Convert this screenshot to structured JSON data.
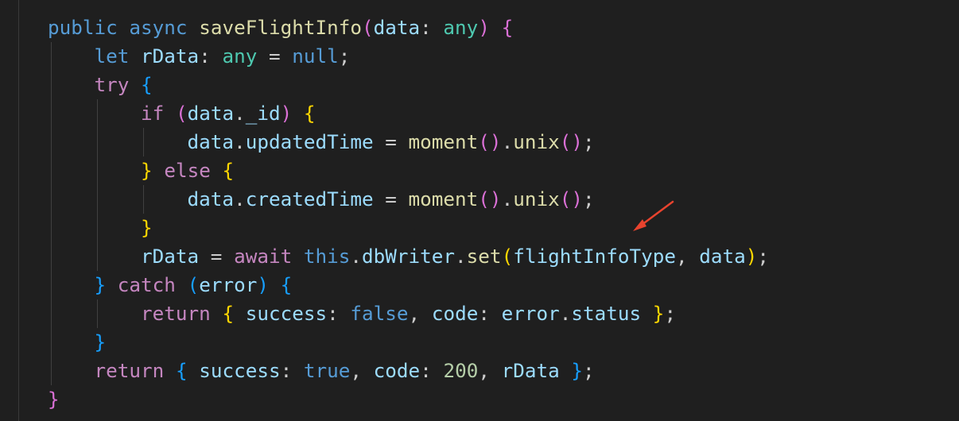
{
  "editor": {
    "lines": [
      {
        "indent": 0,
        "tokens": [
          {
            "t": "public",
            "c": "kw-decl"
          },
          {
            "t": " ",
            "c": "punc"
          },
          {
            "t": "async",
            "c": "kw-decl"
          },
          {
            "t": " ",
            "c": "punc"
          },
          {
            "t": "saveFlightInfo",
            "c": "fn"
          },
          {
            "t": "(",
            "c": "b1"
          },
          {
            "t": "data",
            "c": "var"
          },
          {
            "t": ": ",
            "c": "punc"
          },
          {
            "t": "any",
            "c": "type"
          },
          {
            "t": ")",
            "c": "b1"
          },
          {
            "t": " ",
            "c": "punc"
          },
          {
            "t": "{",
            "c": "b1"
          }
        ]
      },
      {
        "indent": 1,
        "tokens": [
          {
            "t": "let",
            "c": "kw-decl"
          },
          {
            "t": " ",
            "c": "punc"
          },
          {
            "t": "rData",
            "c": "var"
          },
          {
            "t": ": ",
            "c": "punc"
          },
          {
            "t": "any",
            "c": "type"
          },
          {
            "t": " = ",
            "c": "punc"
          },
          {
            "t": "null",
            "c": "kw-decl"
          },
          {
            "t": ";",
            "c": "punc"
          }
        ]
      },
      {
        "indent": 1,
        "tokens": [
          {
            "t": "try",
            "c": "kw-ctrl"
          },
          {
            "t": " ",
            "c": "punc"
          },
          {
            "t": "{",
            "c": "b3"
          }
        ]
      },
      {
        "indent": 2,
        "tokens": [
          {
            "t": "if",
            "c": "kw-ctrl"
          },
          {
            "t": " ",
            "c": "punc"
          },
          {
            "t": "(",
            "c": "b1"
          },
          {
            "t": "data",
            "c": "var"
          },
          {
            "t": ".",
            "c": "punc"
          },
          {
            "t": "_id",
            "c": "var"
          },
          {
            "t": ")",
            "c": "b1"
          },
          {
            "t": " ",
            "c": "punc"
          },
          {
            "t": "{",
            "c": "b2"
          }
        ]
      },
      {
        "indent": 3,
        "tokens": [
          {
            "t": "data",
            "c": "var"
          },
          {
            "t": ".",
            "c": "punc"
          },
          {
            "t": "updatedTime",
            "c": "var"
          },
          {
            "t": " = ",
            "c": "punc"
          },
          {
            "t": "moment",
            "c": "fn"
          },
          {
            "t": "()",
            "c": "b1"
          },
          {
            "t": ".",
            "c": "punc"
          },
          {
            "t": "unix",
            "c": "fn"
          },
          {
            "t": "()",
            "c": "b1"
          },
          {
            "t": ";",
            "c": "punc"
          }
        ]
      },
      {
        "indent": 2,
        "tokens": [
          {
            "t": "}",
            "c": "b2"
          },
          {
            "t": " ",
            "c": "punc"
          },
          {
            "t": "else",
            "c": "kw-ctrl"
          },
          {
            "t": " ",
            "c": "punc"
          },
          {
            "t": "{",
            "c": "b2"
          }
        ]
      },
      {
        "indent": 3,
        "tokens": [
          {
            "t": "data",
            "c": "var"
          },
          {
            "t": ".",
            "c": "punc"
          },
          {
            "t": "createdTime",
            "c": "var"
          },
          {
            "t": " = ",
            "c": "punc"
          },
          {
            "t": "moment",
            "c": "fn"
          },
          {
            "t": "()",
            "c": "b1"
          },
          {
            "t": ".",
            "c": "punc"
          },
          {
            "t": "unix",
            "c": "fn"
          },
          {
            "t": "()",
            "c": "b1"
          },
          {
            "t": ";",
            "c": "punc"
          }
        ]
      },
      {
        "indent": 2,
        "tokens": [
          {
            "t": "}",
            "c": "b2"
          }
        ]
      },
      {
        "indent": 2,
        "tokens": [
          {
            "t": "rData",
            "c": "var"
          },
          {
            "t": " = ",
            "c": "punc"
          },
          {
            "t": "await",
            "c": "kw-ctrl"
          },
          {
            "t": " ",
            "c": "punc"
          },
          {
            "t": "this",
            "c": "kw-decl"
          },
          {
            "t": ".",
            "c": "punc"
          },
          {
            "t": "dbWriter",
            "c": "var"
          },
          {
            "t": ".",
            "c": "punc"
          },
          {
            "t": "set",
            "c": "fn"
          },
          {
            "t": "(",
            "c": "b2"
          },
          {
            "t": "flightInfoType",
            "c": "var"
          },
          {
            "t": ", ",
            "c": "punc"
          },
          {
            "t": "data",
            "c": "var"
          },
          {
            "t": ")",
            "c": "b2"
          },
          {
            "t": ";",
            "c": "punc"
          }
        ]
      },
      {
        "indent": 1,
        "tokens": [
          {
            "t": "}",
            "c": "b3"
          },
          {
            "t": " ",
            "c": "punc"
          },
          {
            "t": "catch",
            "c": "kw-ctrl"
          },
          {
            "t": " ",
            "c": "punc"
          },
          {
            "t": "(",
            "c": "b3"
          },
          {
            "t": "error",
            "c": "var"
          },
          {
            "t": ")",
            "c": "b3"
          },
          {
            "t": " ",
            "c": "punc"
          },
          {
            "t": "{",
            "c": "b3"
          }
        ]
      },
      {
        "indent": 2,
        "tokens": [
          {
            "t": "return",
            "c": "kw-ctrl"
          },
          {
            "t": " ",
            "c": "punc"
          },
          {
            "t": "{",
            "c": "b2"
          },
          {
            "t": " ",
            "c": "punc"
          },
          {
            "t": "success",
            "c": "var"
          },
          {
            "t": ": ",
            "c": "punc"
          },
          {
            "t": "false",
            "c": "kw-decl"
          },
          {
            "t": ", ",
            "c": "punc"
          },
          {
            "t": "code",
            "c": "var"
          },
          {
            "t": ": ",
            "c": "punc"
          },
          {
            "t": "error",
            "c": "var"
          },
          {
            "t": ".",
            "c": "punc"
          },
          {
            "t": "status",
            "c": "var"
          },
          {
            "t": " ",
            "c": "punc"
          },
          {
            "t": "}",
            "c": "b2"
          },
          {
            "t": ";",
            "c": "punc"
          }
        ]
      },
      {
        "indent": 1,
        "tokens": [
          {
            "t": "}",
            "c": "b3"
          }
        ]
      },
      {
        "indent": 1,
        "tokens": [
          {
            "t": "return",
            "c": "kw-ctrl"
          },
          {
            "t": " ",
            "c": "punc"
          },
          {
            "t": "{",
            "c": "b3"
          },
          {
            "t": " ",
            "c": "punc"
          },
          {
            "t": "success",
            "c": "var"
          },
          {
            "t": ": ",
            "c": "punc"
          },
          {
            "t": "true",
            "c": "kw-decl"
          },
          {
            "t": ", ",
            "c": "punc"
          },
          {
            "t": "code",
            "c": "var"
          },
          {
            "t": ": ",
            "c": "punc"
          },
          {
            "t": "200",
            "c": "num"
          },
          {
            "t": ", ",
            "c": "punc"
          },
          {
            "t": "rData",
            "c": "var"
          },
          {
            "t": " ",
            "c": "punc"
          },
          {
            "t": "}",
            "c": "b3"
          },
          {
            "t": ";",
            "c": "punc"
          }
        ]
      },
      {
        "indent": 0,
        "tokens": [
          {
            "t": "}",
            "c": "b1"
          }
        ]
      }
    ]
  },
  "annotation": {
    "arrow_color": "#e8432e",
    "icon": "red-arrow-icon"
  },
  "colors": {
    "background": "#1f1f1f",
    "keyword": "#569cd6",
    "control": "#c586c0",
    "function": "#dcdcaa",
    "variable": "#9cdcfe",
    "type": "#4ec9b0",
    "number": "#b5cea8"
  }
}
